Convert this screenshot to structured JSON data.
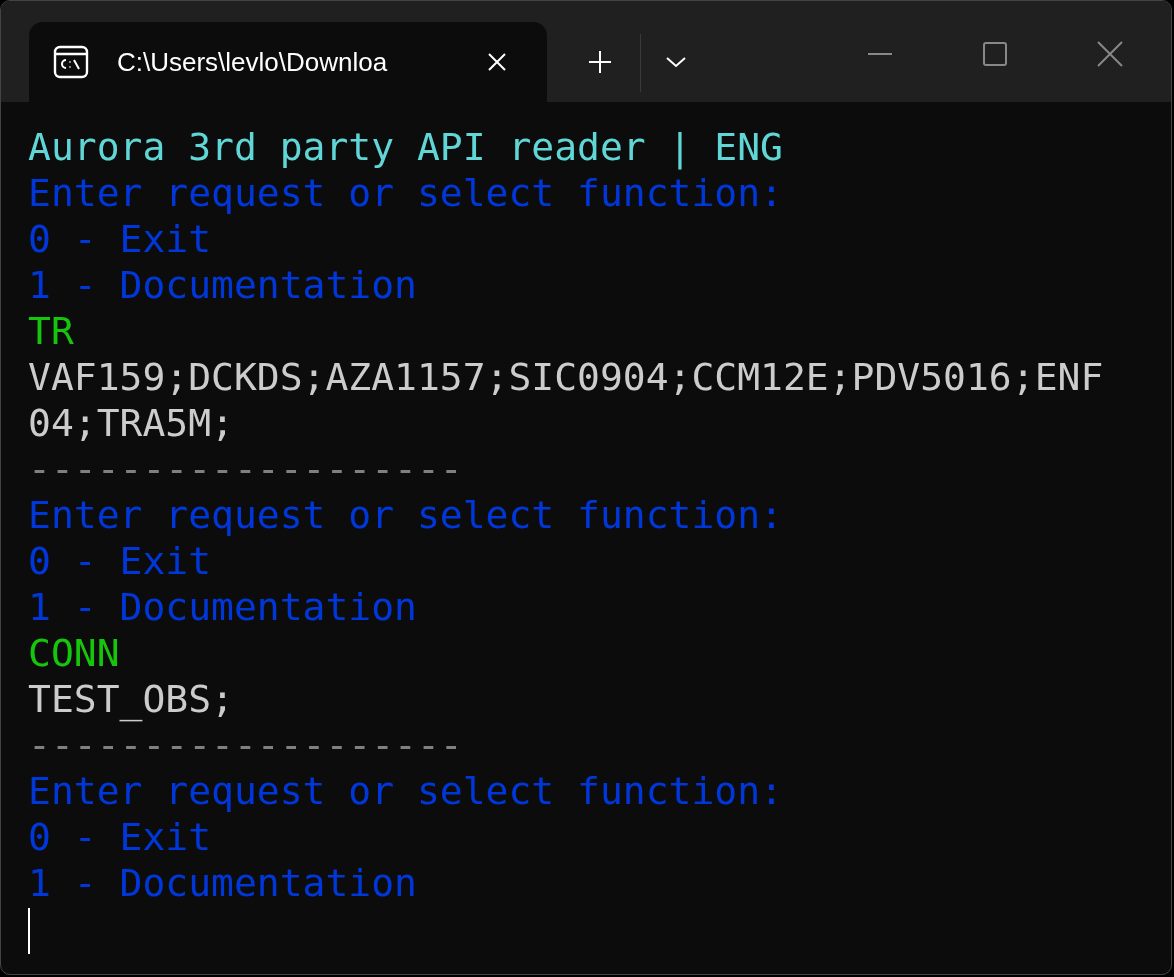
{
  "window": {
    "tab_title": "C:\\Users\\levlo\\Downloa"
  },
  "terminal": {
    "lines": [
      {
        "kind": "header",
        "text": "Aurora 3rd party API reader | ENG"
      },
      {
        "kind": "prompt",
        "text": "Enter request or select function:"
      },
      {
        "kind": "prompt",
        "text": "0 - Exit"
      },
      {
        "kind": "prompt",
        "text": "1 - Documentation"
      },
      {
        "kind": "input",
        "text": "TR"
      },
      {
        "kind": "output",
        "text": "VAF159;DCKDS;AZA1157;SIC0904;CCM12E;PDV5016;ENF04;TRA5M;"
      },
      {
        "kind": "separator",
        "text": "-------------------"
      },
      {
        "kind": "prompt",
        "text": "Enter request or select function:"
      },
      {
        "kind": "prompt",
        "text": "0 - Exit"
      },
      {
        "kind": "prompt",
        "text": "1 - Documentation"
      },
      {
        "kind": "input",
        "text": "CONN"
      },
      {
        "kind": "output",
        "text": "TEST_OBS;"
      },
      {
        "kind": "separator",
        "text": "-------------------"
      },
      {
        "kind": "prompt",
        "text": "Enter request or select function:"
      },
      {
        "kind": "prompt",
        "text": "0 - Exit"
      },
      {
        "kind": "prompt",
        "text": "1 - Documentation"
      }
    ]
  }
}
